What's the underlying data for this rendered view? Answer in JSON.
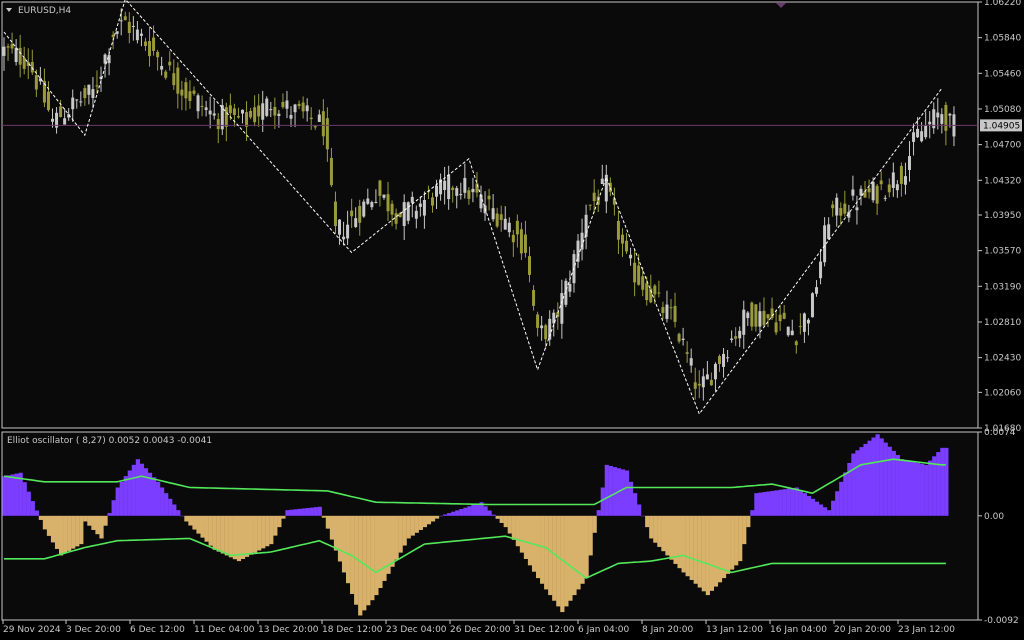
{
  "symbol_label": "EURUSD,H4",
  "indicator_label": "Elliot oscillator ( 8,27) 0.0052 0.0043 -0.0041",
  "current_price": "1.04905",
  "colors": {
    "background": "#0a0a0a",
    "frame": "#c8c8c8",
    "bull_candle": "#c8c8c8",
    "bear_candle": "#9a9a3a",
    "zigzag": "#ffffff",
    "price_line": "#6a3a6a",
    "hist_positive": "#7b3dff",
    "hist_negative": "#d8b26a",
    "signal_line": "#52e85a"
  },
  "chart_data": [
    {
      "type": "candlestick",
      "title": "EURUSD,H4",
      "y_ticks": [
        "1.06220",
        "1.05840",
        "1.05460",
        "1.05080",
        "1.04700",
        "1.04320",
        "1.03950",
        "1.03570",
        "1.03190",
        "1.02810",
        "1.02430",
        "1.02060",
        "1.01680"
      ],
      "ylim": [
        1.0168,
        1.0622
      ],
      "x_ticks": [
        "29 Nov 2024",
        "3 Dec 20:00",
        "6 Dec 12:00",
        "11 Dec 04:00",
        "13 Dec 20:00",
        "18 Dec 12:00",
        "23 Dec 04:00",
        "26 Dec 20:00",
        "31 Dec 12:00",
        "6 Jan 04:00",
        "8 Jan 20:00",
        "13 Jan 12:00",
        "16 Jan 04:00",
        "20 Jan 20:00",
        "23 Jan 12:00"
      ],
      "current_price": 1.04905,
      "zigzag_pivots": [
        {
          "x": 0,
          "y": 1.059
        },
        {
          "x": 20,
          "y": 1.048
        },
        {
          "x": 30,
          "y": 1.0625
        },
        {
          "x": 86,
          "y": 1.0355
        },
        {
          "x": 115,
          "y": 1.0455
        },
        {
          "x": 132,
          "y": 1.023
        },
        {
          "x": 149,
          "y": 1.0435
        },
        {
          "x": 172,
          "y": 1.0183
        },
        {
          "x": 232,
          "y": 1.053
        }
      ],
      "close_path": [
        {
          "x": 0,
          "y": 1.057
        },
        {
          "x": 6,
          "y": 1.056
        },
        {
          "x": 12,
          "y": 1.0495
        },
        {
          "x": 18,
          "y": 1.0515
        },
        {
          "x": 22,
          "y": 1.0525
        },
        {
          "x": 27,
          "y": 1.059
        },
        {
          "x": 30,
          "y": 1.06
        },
        {
          "x": 36,
          "y": 1.0575
        },
        {
          "x": 44,
          "y": 1.053
        },
        {
          "x": 52,
          "y": 1.05
        },
        {
          "x": 60,
          "y": 1.0495
        },
        {
          "x": 66,
          "y": 1.0515
        },
        {
          "x": 72,
          "y": 1.0505
        },
        {
          "x": 79,
          "y": 1.049
        },
        {
          "x": 82,
          "y": 1.0375
        },
        {
          "x": 86,
          "y": 1.039
        },
        {
          "x": 92,
          "y": 1.042
        },
        {
          "x": 98,
          "y": 1.0395
        },
        {
          "x": 104,
          "y": 1.041
        },
        {
          "x": 112,
          "y": 1.043
        },
        {
          "x": 118,
          "y": 1.041
        },
        {
          "x": 124,
          "y": 1.039
        },
        {
          "x": 129,
          "y": 1.036
        },
        {
          "x": 132,
          "y": 1.0265
        },
        {
          "x": 136,
          "y": 1.028
        },
        {
          "x": 140,
          "y": 1.033
        },
        {
          "x": 144,
          "y": 1.04
        },
        {
          "x": 149,
          "y": 1.0425
        },
        {
          "x": 154,
          "y": 1.0345
        },
        {
          "x": 160,
          "y": 1.031
        },
        {
          "x": 166,
          "y": 1.028
        },
        {
          "x": 172,
          "y": 1.0205
        },
        {
          "x": 178,
          "y": 1.025
        },
        {
          "x": 184,
          "y": 1.029
        },
        {
          "x": 190,
          "y": 1.0285
        },
        {
          "x": 196,
          "y": 1.027
        },
        {
          "x": 200,
          "y": 1.03
        },
        {
          "x": 204,
          "y": 1.0395
        },
        {
          "x": 210,
          "y": 1.041
        },
        {
          "x": 216,
          "y": 1.042
        },
        {
          "x": 222,
          "y": 1.044
        },
        {
          "x": 226,
          "y": 1.048
        },
        {
          "x": 232,
          "y": 1.0505
        },
        {
          "x": 234,
          "y": 1.049
        }
      ]
    },
    {
      "type": "histogram",
      "title": "Elliot oscillator ( 8,27) 0.0052 0.0043 -0.0041",
      "y_ticks": [
        "0.0074",
        "0.00",
        "-0.0092"
      ],
      "ylim": [
        -0.0092,
        0.0074
      ],
      "oscillator_path": [
        {
          "x": 0,
          "y": 0.0035
        },
        {
          "x": 4,
          "y": 0.0038
        },
        {
          "x": 10,
          "y": -0.0012
        },
        {
          "x": 14,
          "y": -0.0035
        },
        {
          "x": 19,
          "y": -0.0025
        },
        {
          "x": 20,
          "y": -0.0005
        },
        {
          "x": 24,
          "y": -0.002
        },
        {
          "x": 28,
          "y": 0.0025
        },
        {
          "x": 33,
          "y": 0.005
        },
        {
          "x": 38,
          "y": 0.003
        },
        {
          "x": 45,
          "y": -0.0005
        },
        {
          "x": 52,
          "y": -0.003
        },
        {
          "x": 58,
          "y": -0.004
        },
        {
          "x": 66,
          "y": -0.0025
        },
        {
          "x": 70,
          "y": 0.0005
        },
        {
          "x": 78,
          "y": 0.0008
        },
        {
          "x": 84,
          "y": -0.005
        },
        {
          "x": 88,
          "y": -0.0088
        },
        {
          "x": 92,
          "y": -0.007
        },
        {
          "x": 100,
          "y": -0.002
        },
        {
          "x": 108,
          "y": 0.0
        },
        {
          "x": 118,
          "y": 0.0012
        },
        {
          "x": 124,
          "y": -0.001
        },
        {
          "x": 132,
          "y": -0.0055
        },
        {
          "x": 138,
          "y": -0.0085
        },
        {
          "x": 144,
          "y": -0.0055
        },
        {
          "x": 149,
          "y": 0.0045
        },
        {
          "x": 154,
          "y": 0.004
        },
        {
          "x": 160,
          "y": -0.002
        },
        {
          "x": 168,
          "y": -0.005
        },
        {
          "x": 174,
          "y": -0.007
        },
        {
          "x": 182,
          "y": -0.004
        },
        {
          "x": 186,
          "y": 0.002
        },
        {
          "x": 196,
          "y": 0.0025
        },
        {
          "x": 204,
          "y": 0.0005
        },
        {
          "x": 210,
          "y": 0.0055
        },
        {
          "x": 216,
          "y": 0.0072
        },
        {
          "x": 222,
          "y": 0.005
        },
        {
          "x": 228,
          "y": 0.0045
        },
        {
          "x": 232,
          "y": 0.006
        }
      ],
      "upper_signal_path": [
        {
          "x": 0,
          "y": 0.0035
        },
        {
          "x": 10,
          "y": 0.003
        },
        {
          "x": 28,
          "y": 0.003
        },
        {
          "x": 34,
          "y": 0.0035
        },
        {
          "x": 46,
          "y": 0.0025
        },
        {
          "x": 80,
          "y": 0.0022
        },
        {
          "x": 92,
          "y": 0.0012
        },
        {
          "x": 120,
          "y": 0.001
        },
        {
          "x": 146,
          "y": 0.001
        },
        {
          "x": 154,
          "y": 0.0025
        },
        {
          "x": 180,
          "y": 0.0025
        },
        {
          "x": 190,
          "y": 0.0028
        },
        {
          "x": 200,
          "y": 0.002
        },
        {
          "x": 212,
          "y": 0.0045
        },
        {
          "x": 220,
          "y": 0.005
        },
        {
          "x": 232,
          "y": 0.0045
        }
      ],
      "lower_signal_path": [
        {
          "x": 0,
          "y": -0.0038
        },
        {
          "x": 10,
          "y": -0.0038
        },
        {
          "x": 20,
          "y": -0.0028
        },
        {
          "x": 28,
          "y": -0.0022
        },
        {
          "x": 46,
          "y": -0.002
        },
        {
          "x": 56,
          "y": -0.0035
        },
        {
          "x": 66,
          "y": -0.0032
        },
        {
          "x": 78,
          "y": -0.0022
        },
        {
          "x": 86,
          "y": -0.0035
        },
        {
          "x": 92,
          "y": -0.005
        },
        {
          "x": 104,
          "y": -0.0025
        },
        {
          "x": 124,
          "y": -0.0018
        },
        {
          "x": 134,
          "y": -0.0028
        },
        {
          "x": 144,
          "y": -0.0055
        },
        {
          "x": 152,
          "y": -0.0042
        },
        {
          "x": 160,
          "y": -0.004
        },
        {
          "x": 168,
          "y": -0.0035
        },
        {
          "x": 180,
          "y": -0.005
        },
        {
          "x": 190,
          "y": -0.0042
        },
        {
          "x": 232,
          "y": -0.0042
        }
      ]
    }
  ]
}
